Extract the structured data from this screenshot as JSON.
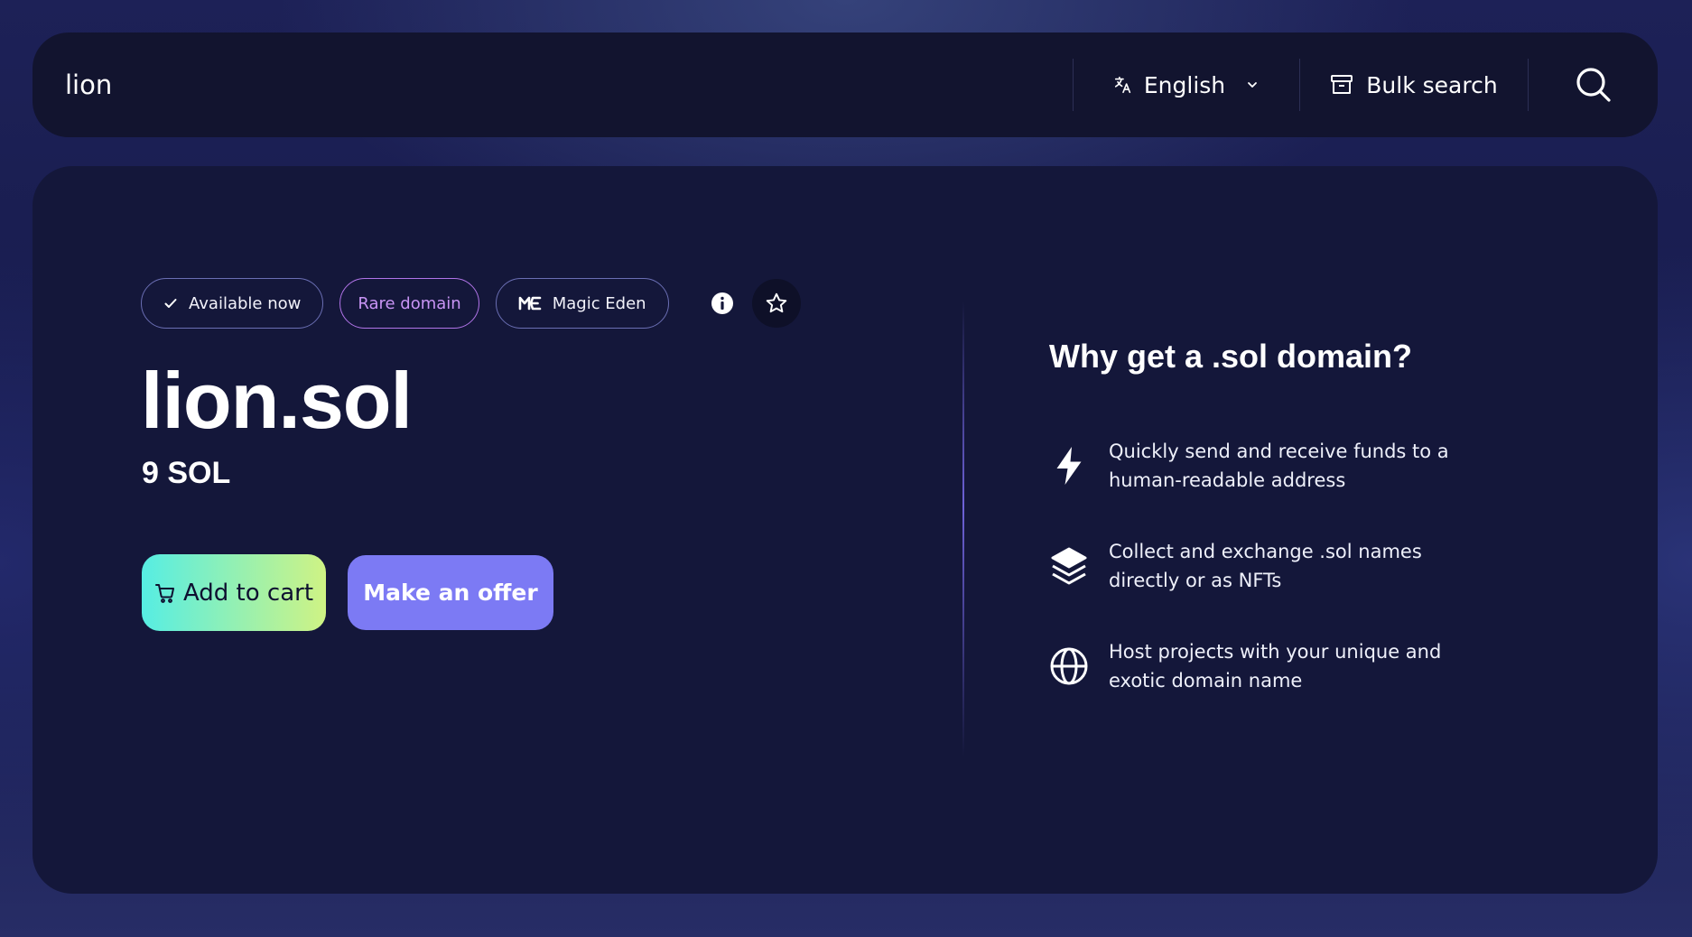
{
  "header": {
    "search_value": "lion",
    "language_label": "English",
    "bulk_search_label": "Bulk search"
  },
  "domain": {
    "badges": {
      "available": "Available now",
      "rare": "Rare domain",
      "marketplace": "Magic Eden"
    },
    "name": "lion.sol",
    "price": "9 SOL",
    "add_to_cart_label": "Add to cart",
    "make_offer_label": "Make an offer"
  },
  "why": {
    "title": "Why get a .sol domain?",
    "features": [
      {
        "icon": "lightning-icon",
        "text": "Quickly send and receive funds to a human-readable address"
      },
      {
        "icon": "layers-icon",
        "text": "Collect and exchange .sol names directly or as NFTs"
      },
      {
        "icon": "globe-icon",
        "text": "Host projects with your unique and exotic domain name"
      }
    ]
  },
  "colors": {
    "card_bg": "#14173a",
    "cart_gradient_start": "#56ede3",
    "cart_gradient_end": "#cff384",
    "offer_button": "#7c7af4",
    "rare_badge": "#b174e8"
  }
}
